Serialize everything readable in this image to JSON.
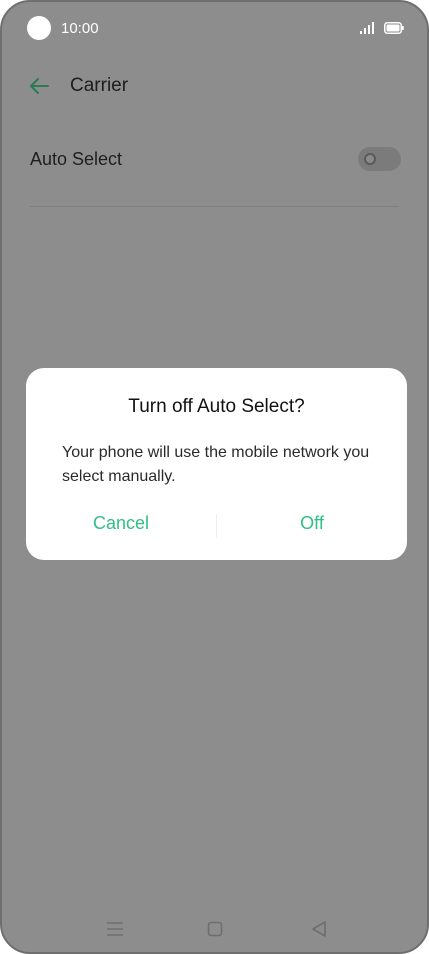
{
  "status_bar": {
    "time": "10:00",
    "icons": [
      "camera-cutout",
      "signal-icon",
      "battery-icon"
    ]
  },
  "header": {
    "title": "Carrier",
    "back_icon": "arrow-left-icon",
    "accent_color": "#2fc083"
  },
  "settings": {
    "auto_select": {
      "label": "Auto Select",
      "toggle_state": "off"
    }
  },
  "dialog": {
    "title": "Turn off Auto Select?",
    "message": "Your phone will use the mobile network you select manually.",
    "cancel_label": "Cancel",
    "confirm_label": "Off",
    "button_color": "#2fc083"
  },
  "nav_bar": {
    "icons": [
      "menu-icon",
      "home-icon",
      "back-icon"
    ]
  }
}
